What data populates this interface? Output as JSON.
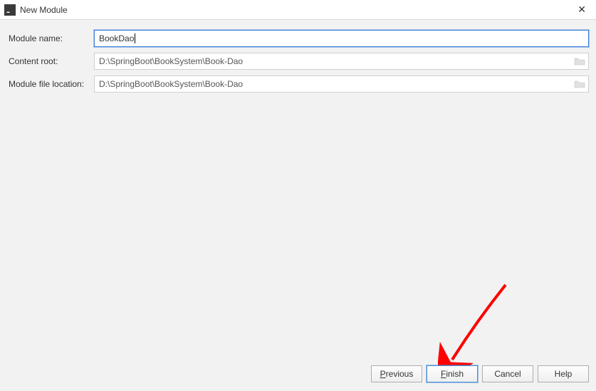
{
  "window": {
    "title": "New Module",
    "app_icon_letter": "IJ"
  },
  "form": {
    "module_name_label": "Module name:",
    "module_name_value": "BookDao",
    "content_root_label": "Content root:",
    "content_root_value": "D:\\SpringBoot\\BookSystem\\Book-Dao",
    "module_file_loc_label": "Module file location:",
    "module_file_loc_value": "D:\\SpringBoot\\BookSystem\\Book-Dao"
  },
  "buttons": {
    "previous": "Previous",
    "previous_ul": "P",
    "previous_rest": "revious",
    "finish": "Finish",
    "finish_ul": "F",
    "finish_rest": "inish",
    "cancel": "Cancel",
    "help": "Help"
  }
}
